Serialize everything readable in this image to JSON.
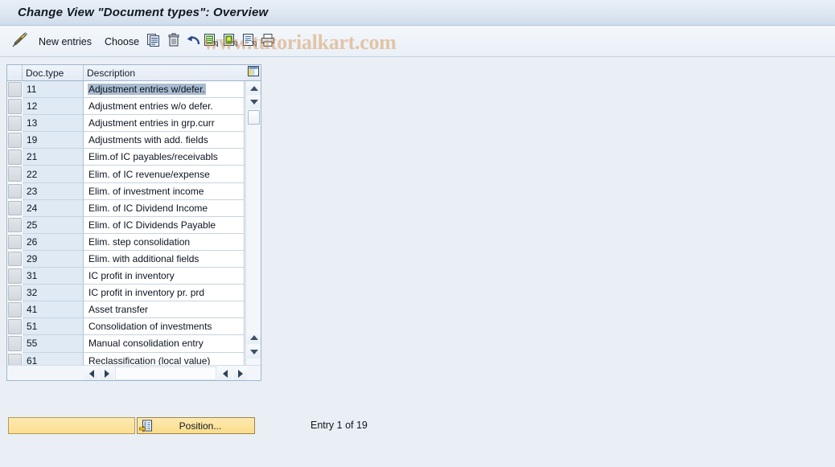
{
  "window": {
    "title": "Change View \"Document types\": Overview"
  },
  "watermark": {
    "text": "www.tutorialkart.com",
    "color": "#d6914f"
  },
  "toolbar": {
    "items": [
      {
        "name": "display-change-icon",
        "label": "",
        "icon": "pencil-icon"
      },
      {
        "name": "new-entries-button",
        "label": "New entries",
        "icon": ""
      },
      {
        "name": "choose-button",
        "label": "Choose",
        "icon": ""
      },
      {
        "name": "copy-as-button",
        "label": "",
        "icon": "copy-icon"
      },
      {
        "name": "delete-button",
        "label": "",
        "icon": "trash-icon"
      },
      {
        "name": "undo-button",
        "label": "",
        "icon": "undo-icon"
      },
      {
        "name": "select-all-button",
        "label": "",
        "icon": "select-all-icon"
      },
      {
        "name": "deselect-all-button",
        "label": "",
        "icon": "deselect-all-icon"
      },
      {
        "name": "variant-button",
        "label": "",
        "icon": "variant-icon"
      },
      {
        "name": "print-button",
        "label": "",
        "icon": "printer-icon"
      }
    ],
    "new_entries_label": "New entries",
    "choose_label": "Choose"
  },
  "table": {
    "columns": [
      {
        "key": "doctype",
        "label": "Doc.type"
      },
      {
        "key": "description",
        "label": "Description"
      }
    ],
    "config_icon": "table-settings-icon",
    "selected_row_index": 0,
    "rows": [
      {
        "doctype": "11",
        "description": "Adjustment entries w/defer."
      },
      {
        "doctype": "12",
        "description": "Adjustment entries w/o defer."
      },
      {
        "doctype": "13",
        "description": "Adjustment entries in grp.curr"
      },
      {
        "doctype": "19",
        "description": "Adjustments with add. fields"
      },
      {
        "doctype": "21",
        "description": "Elim.of IC payables/receivabls"
      },
      {
        "doctype": "22",
        "description": "Elim. of IC revenue/expense"
      },
      {
        "doctype": "23",
        "description": "Elim. of investment income"
      },
      {
        "doctype": "24",
        "description": "Elim. of IC Dividend Income"
      },
      {
        "doctype": "25",
        "description": "Elim. of IC Dividends Payable"
      },
      {
        "doctype": "26",
        "description": "Elim. step consolidation"
      },
      {
        "doctype": "29",
        "description": "Elim. with additional fields"
      },
      {
        "doctype": "31",
        "description": "IC profit in inventory"
      },
      {
        "doctype": "32",
        "description": "IC profit in inventory pr. prd"
      },
      {
        "doctype": "41",
        "description": "Asset transfer"
      },
      {
        "doctype": "51",
        "description": "Consolidation of investments"
      },
      {
        "doctype": "55",
        "description": "Manual consolidation entry"
      },
      {
        "doctype": "61",
        "description": "Reclassification (local value)"
      }
    ]
  },
  "footer": {
    "position_input_value": "",
    "position_input_placeholder": "",
    "position_button_label": "Position...",
    "position_button_icon": "position-icon",
    "entry_status": "Entry 1 of 19"
  }
}
